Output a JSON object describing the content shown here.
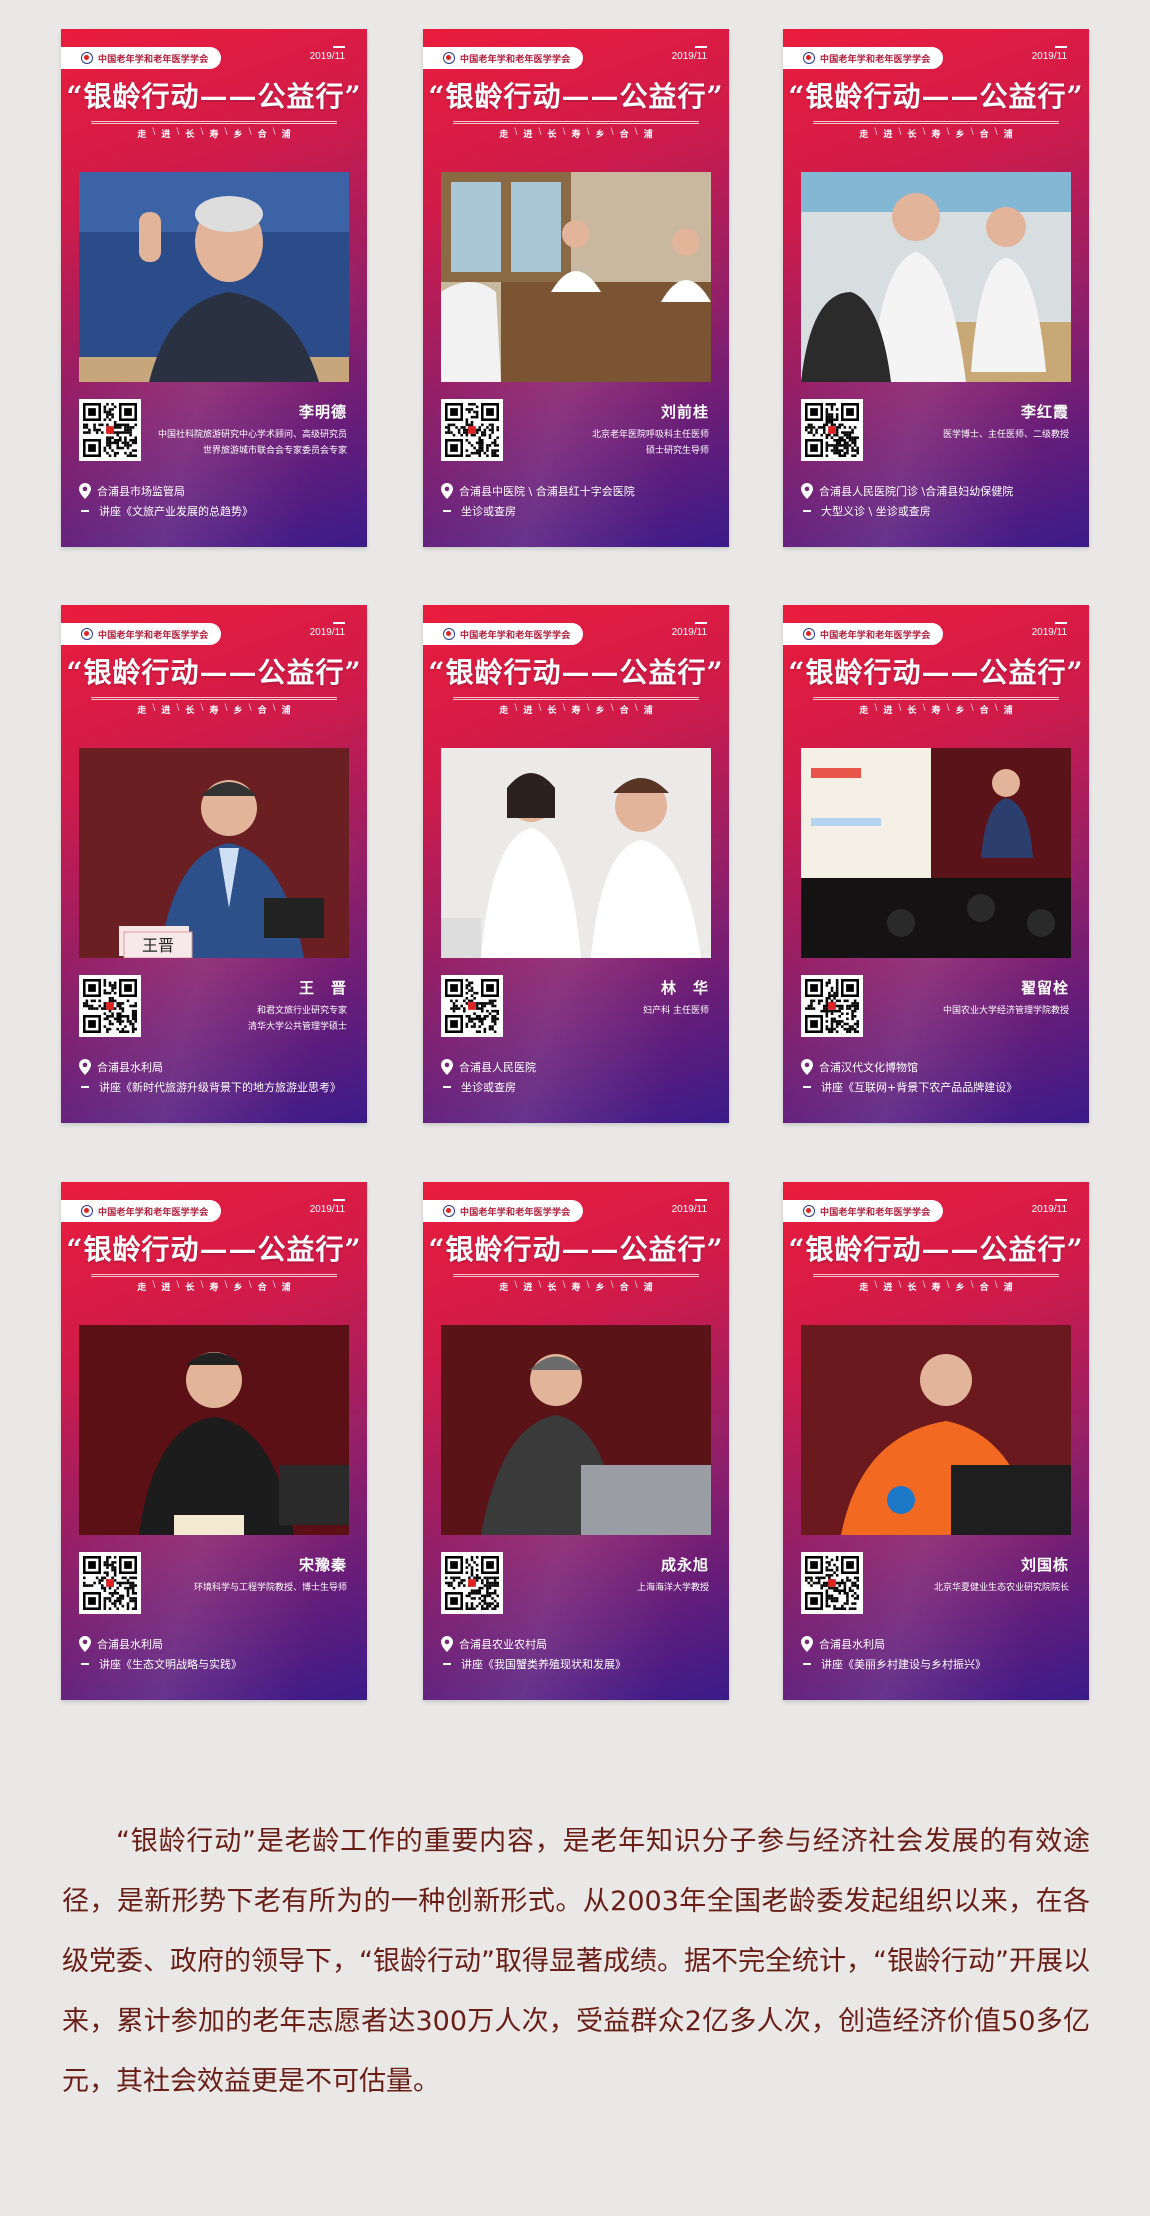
{
  "common": {
    "org": "中国老年学和老年医学学会",
    "date": "2019/11",
    "headline": "“银龄行动——公益行”",
    "slogan": [
      "走",
      "进",
      "长",
      "寿",
      "乡",
      "合",
      "浦"
    ]
  },
  "cards": [
    {
      "name": "李明德",
      "titles": [
        "中国社科院旅游研究中心学术顾问、高级研究员",
        "世界旅游城市联合会专家委员会专家"
      ],
      "location": "合浦县市场监管局",
      "talk": "讲座《文旅产业发展的总趋势》",
      "photo_caption": "",
      "bg": "#2b4c88"
    },
    {
      "name": "刘前桂",
      "titles": [
        "北京老年医院呼吸科主任医师",
        "硕士研究生导师"
      ],
      "location": "合浦县中医院 \\ 合浦县红十字会医院",
      "talk": "坐诊或查房",
      "photo_caption": "",
      "bg": "#c9b8a0"
    },
    {
      "name": "李红霞",
      "titles": [
        "医学博士、主任医师、二级教授"
      ],
      "location": "合浦县人民医院门诊 \\合浦县妇幼保健院",
      "talk": "大型义诊 \\ 坐诊或查房",
      "photo_caption": "",
      "bg": "#d8dde0"
    },
    {
      "name": "王　晋",
      "titles": [
        "和君文旅行业研究专家",
        "清华大学公共管理学硕士"
      ],
      "location": "合浦县水利局",
      "talk": "讲座《新时代旅游升级背景下的地方旅游业思考》",
      "photo_caption": "王晋",
      "bg": "#5a1a1e"
    },
    {
      "name": "林　华",
      "titles": [
        "妇产科 主任医师"
      ],
      "location": "合浦县人民医院",
      "talk": "坐诊或查房",
      "photo_caption": "",
      "bg": "#e6e4e2"
    },
    {
      "name": "翟留栓",
      "titles": [
        "中国农业大学经济管理学院教授"
      ],
      "location": "合浦汉代文化博物馆",
      "talk": "讲座《互联网+背景下农产品品牌建设》",
      "photo_caption": "",
      "bg": "#3a1218"
    },
    {
      "name": "宋豫秦",
      "titles": [
        "环境科学与工程学院教授、博士生导师"
      ],
      "location": "合浦县水利局",
      "talk": "讲座《生态文明战略与实践》",
      "photo_caption": "",
      "bg": "#4a0e14"
    },
    {
      "name": "成永旭",
      "titles": [
        "上海海洋大学教授"
      ],
      "location": "合浦县农业农村局",
      "talk": "讲座《我国蟹类养殖现状和发展》",
      "photo_caption": "",
      "bg": "#4a1216"
    },
    {
      "name": "刘国栋",
      "titles": [
        "北京华夏健业生态农业研究院院长"
      ],
      "location": "合浦县水利局",
      "talk": "讲座《美丽乡村建设与乡村振兴》",
      "photo_caption": "",
      "bg": "#5a1418"
    }
  ],
  "paragraph": "“银龄行动”是老龄工作的重要内容，是老年知识分子参与经济社会发展的有效途径，是新形势下老有所为的一种创新形式。从2003年全国老龄委发起组织以来，在各级党委、政府的领导下，“银龄行动”取得显著成绩。据不完全统计，“银龄行动”开展以来，累计参加的老年志愿者达300万人次，受益群众2亿多人次，创造经济价值50多亿元，其社会效益更是不可估量。"
}
